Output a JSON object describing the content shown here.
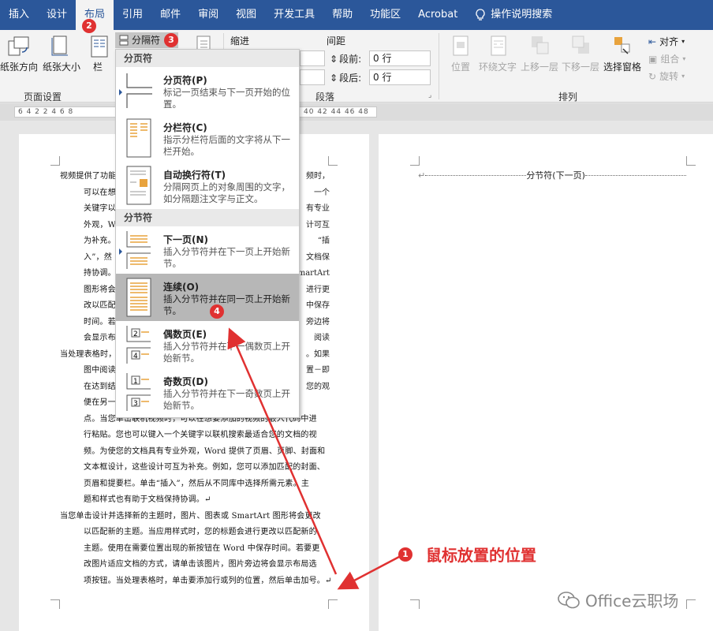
{
  "tabs": [
    "插入",
    "设计",
    "布局",
    "引用",
    "邮件",
    "审阅",
    "视图",
    "开发工具",
    "帮助",
    "功能区",
    "Acrobat",
    "操作说明搜索"
  ],
  "ribbon": {
    "orientation": "纸张方向",
    "size": "纸张大小",
    "columns": "栏",
    "breaks_btn": "分隔符",
    "indent_label": "缩进",
    "spacing_label": "间距",
    "before_label": "段前:",
    "before_value": "0 行",
    "after_label": "段后:",
    "after_value": "0 行",
    "group_pagesetup": "页面设置",
    "group_paragraph": "段落",
    "group_arrange": "排列",
    "position": "位置",
    "wrap": "环绕文字",
    "forward": "上移一层",
    "backward": "下移一层",
    "selpane": "选择窗格",
    "align": "对齐",
    "group": "组合",
    "rotate": "旋转"
  },
  "ruler": {
    "left": "6  4  2     2     4  6  8",
    "right": "40 42 44 46 48"
  },
  "dropdown": {
    "page_breaks_header": "分页符",
    "section_breaks_header": "分节符",
    "items": [
      {
        "title": "分页符(P)",
        "desc": "标记一页结束与下一页开始的位置。"
      },
      {
        "title": "分栏符(C)",
        "desc": "指示分栏符后面的文字将从下一栏开始。"
      },
      {
        "title": "自动换行符(T)",
        "desc": "分隔网页上的对象周围的文字，如分隔题注文字与正文。"
      },
      {
        "title": "下一页(N)",
        "desc": "插入分节符并在下一页上开始新节。"
      },
      {
        "title": "连续(O)",
        "desc": "插入分节符并在同一页上开始新节。"
      },
      {
        "title": "偶数页(E)",
        "desc": "插入分节符并在下一偶数页上开始新节。"
      },
      {
        "title": "奇数页(D)",
        "desc": "插入分节符并在下一奇数页上开始新节。"
      }
    ]
  },
  "doc1": [
    "视频提供了功能",
    "可以在想",
    "关键字以",
    "外观，Wor",
    "为补充。",
    "入”，然",
    "持协调。",
    "图形将会",
    "改以匹配",
    "时间。若",
    "会显示布",
    "当处理表格时，",
    "图中阅读",
    "在达到结",
    "便在另一",
    "点。当您单击联机视频时，可以在想要添加的视频的嵌入代码中进",
    "行粘贴。您也可以键入一个关键字以联机搜索最适合您的文档的视",
    "频。为使您的文档具有专业外观，Word 提供了页眉、页脚、封面和",
    "文本框设计，这些设计可互为补充。例如，您可以添加匹配的封面、",
    "页眉和提要栏。单击“插入”，然后从不同库中选择所需元素。主",
    "题和样式也有助于文档保持协调。↵",
    "当您单击设计并选择新的主题时，图片、图表或 SmartArt 图形将会更改",
    "以匹配新的主题。当应用样式时，您的标题会进行更改以匹配新的",
    "主题。使用在需要位置出现的新按钮在 Word 中保存时间。若要更",
    "改图片适应文档的方式，请单击该图片，图片旁边将会显示布局选",
    "项按钮。当处理表格时，单击要添加行或列的位置，然后单击加号。↵"
  ],
  "doc1_right": [
    "频时，",
    "一个",
    "有专业",
    "计可互",
    "“插",
    "文档保",
    "SmartArt",
    "进行更",
    "中保存",
    "旁边将",
    "阅读",
    "。如果",
    "置－即",
    "您的观"
  ],
  "section_break": "分节符(下一页)",
  "badges": [
    "1",
    "2",
    "3",
    "4"
  ],
  "note": "鼠标放置的位置",
  "watermark": "Office云职场"
}
